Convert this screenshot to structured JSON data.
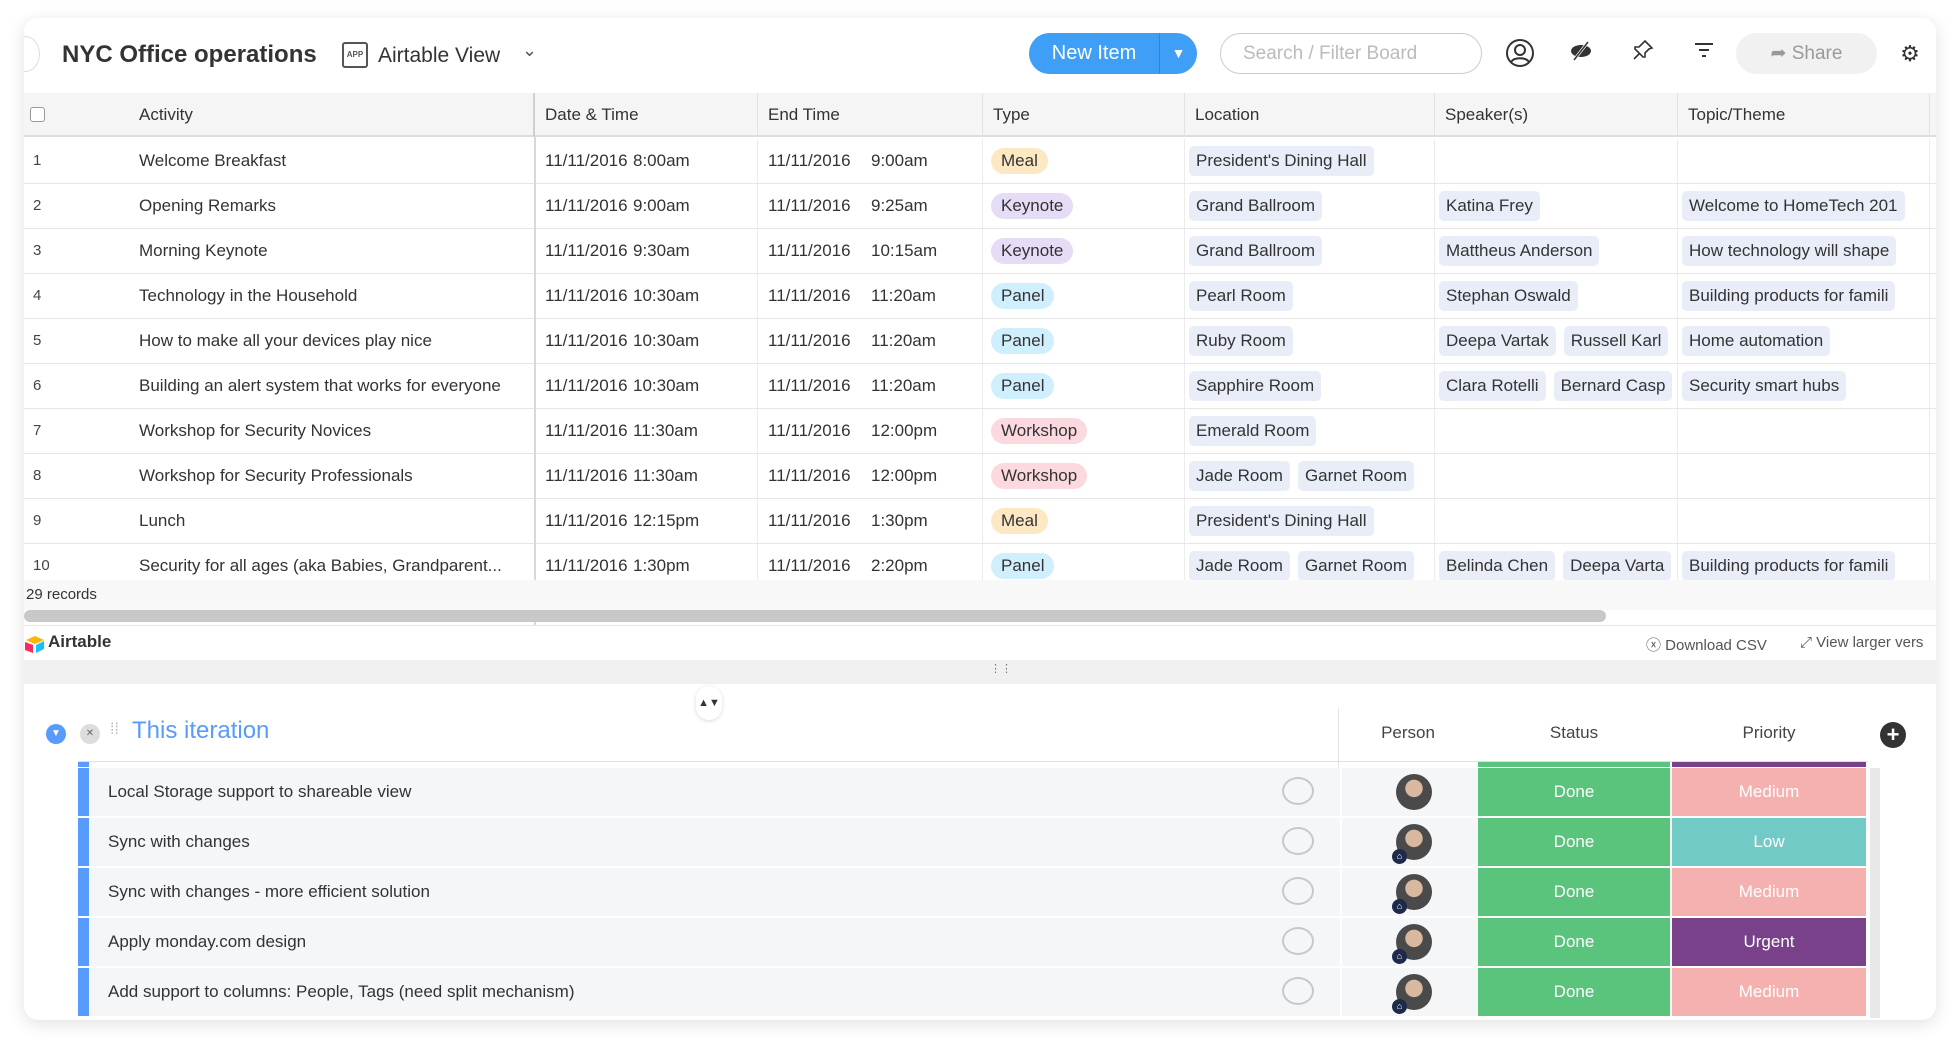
{
  "header": {
    "title": "NYC Office operations",
    "view_icon_text": "APP",
    "view_name": "Airtable View",
    "new_item_label": "New Item",
    "search_placeholder": "Search / Filter Board",
    "share_label": "Share"
  },
  "colors": {
    "accent": "#3f9ef6",
    "group": "#579bfc",
    "done": "#5ac47d",
    "medium": "#f5b1b0",
    "low": "#72cac6",
    "urgent": "#784189"
  },
  "table": {
    "columns": [
      "Activity",
      "Date & Time",
      "End Time",
      "Type",
      "Location",
      "Speaker(s)",
      "Topic/Theme"
    ],
    "rows": [
      {
        "n": "1",
        "activity": "Welcome Breakfast",
        "date": "11/11/2016",
        "time": "8:00am",
        "end_date": "11/11/2016",
        "end_time": "9:00am",
        "type": "Meal",
        "location": [
          "President's Dining Hall"
        ],
        "speakers": [],
        "topic": []
      },
      {
        "n": "2",
        "activity": "Opening Remarks",
        "date": "11/11/2016",
        "time": "9:00am",
        "end_date": "11/11/2016",
        "end_time": "9:25am",
        "type": "Keynote",
        "location": [
          "Grand Ballroom"
        ],
        "speakers": [
          "Katina Frey"
        ],
        "topic": [
          "Welcome to HomeTech 201"
        ]
      },
      {
        "n": "3",
        "activity": "Morning Keynote",
        "date": "11/11/2016",
        "time": "9:30am",
        "end_date": "11/11/2016",
        "end_time": "10:15am",
        "type": "Keynote",
        "location": [
          "Grand Ballroom"
        ],
        "speakers": [
          "Mattheus Anderson"
        ],
        "topic": [
          "How technology will shape"
        ]
      },
      {
        "n": "4",
        "activity": "Technology in the Household",
        "date": "11/11/2016",
        "time": "10:30am",
        "end_date": "11/11/2016",
        "end_time": "11:20am",
        "type": "Panel",
        "location": [
          "Pearl Room"
        ],
        "speakers": [
          "Stephan Oswald"
        ],
        "topic": [
          "Building products for famili"
        ]
      },
      {
        "n": "5",
        "activity": "How to make all your devices play nice",
        "date": "11/11/2016",
        "time": "10:30am",
        "end_date": "11/11/2016",
        "end_time": "11:20am",
        "type": "Panel",
        "location": [
          "Ruby Room"
        ],
        "speakers": [
          "Deepa Vartak",
          "Russell Karl"
        ],
        "topic": [
          "Home automation"
        ]
      },
      {
        "n": "6",
        "activity": "Building an alert system that works for everyone",
        "date": "11/11/2016",
        "time": "10:30am",
        "end_date": "11/11/2016",
        "end_time": "11:20am",
        "type": "Panel",
        "location": [
          "Sapphire Room"
        ],
        "speakers": [
          "Clara Rotelli",
          "Bernard Casp"
        ],
        "topic": [
          "Security smart hubs"
        ]
      },
      {
        "n": "7",
        "activity": "Workshop for Security Novices",
        "date": "11/11/2016",
        "time": "11:30am",
        "end_date": "11/11/2016",
        "end_time": "12:00pm",
        "type": "Workshop",
        "location": [
          "Emerald Room"
        ],
        "speakers": [],
        "topic": []
      },
      {
        "n": "8",
        "activity": "Workshop for Security Professionals",
        "date": "11/11/2016",
        "time": "11:30am",
        "end_date": "11/11/2016",
        "end_time": "12:00pm",
        "type": "Workshop",
        "location": [
          "Jade Room",
          "Garnet Room"
        ],
        "speakers": [],
        "topic": []
      },
      {
        "n": "9",
        "activity": "Lunch",
        "date": "11/11/2016",
        "time": "12:15pm",
        "end_date": "11/11/2016",
        "end_time": "1:30pm",
        "type": "Meal",
        "location": [
          "President's Dining Hall"
        ],
        "speakers": [],
        "topic": []
      },
      {
        "n": "10",
        "activity": "Security for all ages (aka Babies, Grandparent...",
        "date": "11/11/2016",
        "time": "1:30pm",
        "end_date": "11/11/2016",
        "end_time": "2:20pm",
        "type": "Panel",
        "location": [
          "Jade Room",
          "Garnet Room"
        ],
        "speakers": [
          "Belinda Chen",
          "Deepa Varta"
        ],
        "topic": [
          "Building products for famili"
        ]
      }
    ],
    "type_colors": {
      "Meal": "#fde8c4",
      "Keynote": "#e6dcf6",
      "Panel": "#d0effc",
      "Workshop": "#fcd9df"
    },
    "records": "29 records"
  },
  "airtable_bar": {
    "logo": "Airtable",
    "download": "Download CSV",
    "view_larger": "View larger vers"
  },
  "board": {
    "group_title": "This iteration",
    "columns": [
      "Person",
      "Status",
      "Priority"
    ],
    "items": [
      {
        "name": "Local Storage support to shareable view",
        "status": "Done",
        "priority": "Medium",
        "home": false
      },
      {
        "name": "Sync with changes",
        "status": "Done",
        "priority": "Low",
        "home": true
      },
      {
        "name": "Sync with changes - more efficient solution",
        "status": "Done",
        "priority": "Medium",
        "home": true
      },
      {
        "name": "Apply monday.com design",
        "status": "Done",
        "priority": "Urgent",
        "home": true
      },
      {
        "name": "Add support to columns: People, Tags (need split mechanism)",
        "status": "Done",
        "priority": "Medium",
        "home": true
      }
    ]
  }
}
